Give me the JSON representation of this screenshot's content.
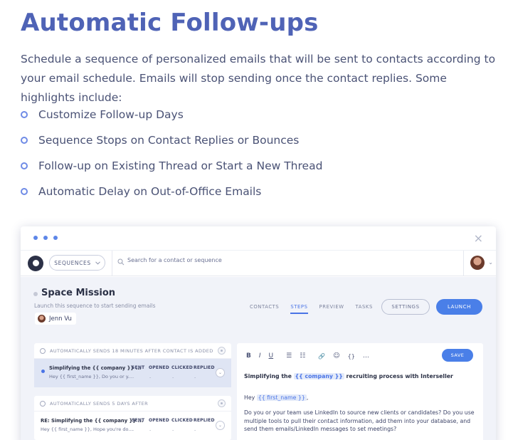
{
  "hero": {
    "title": "Automatic Follow-ups",
    "description": "Schedule a sequence of personalized emails that will be sent to contacts according to your email schedule. Emails will stop sending once the contact replies. Some highlights include:",
    "highlights": [
      "Customize Follow-up Days",
      "Sequence Stops on Contact Replies or Bounces",
      "Follow-up on Existing Thread or Start a New Thread",
      "Automatic Delay on Out-of-Office Emails"
    ]
  },
  "app": {
    "window": {
      "close_icon": "×"
    },
    "nav": {
      "sequences_label": "SEQUENCES",
      "search_placeholder": "Search for a contact or sequence"
    },
    "sequence": {
      "title": "Space Mission",
      "subtitle": "Launch this sequence to start sending emails",
      "owner": "Jenn Vu"
    },
    "tabs": [
      "CONTACTS",
      "STEPS",
      "PREVIEW",
      "TASKS"
    ],
    "active_tab": "STEPS",
    "settings_label": "SETTINGS",
    "launch_label": "LAUNCH",
    "stat_headers": [
      "SENT",
      "OPENED",
      "CLICKED",
      "REPLIED"
    ],
    "steps": [
      {
        "header": "AUTOMATICALLY SENDS 18 MINUTES AFTER CONTACT IS ADDED",
        "subject": "Simplifying the {{ company }} ...",
        "snippet": "Hey {{ first_name }}, Do you or y...",
        "stats": [
          "-",
          "-",
          "-",
          "-"
        ]
      },
      {
        "header": "AUTOMATICALLY SENDS 5 DAYS AFTER",
        "subject": "RE: Simplifying the {{ company }} ...",
        "snippet": "Hey {{ first_name }}, Hope you're do...",
        "stats": [
          "-",
          "-",
          "-",
          "-"
        ]
      }
    ],
    "editor": {
      "toolbar": [
        "B",
        "I",
        "U",
        "☰",
        "☷",
        "🔗",
        "☺",
        "{}",
        "…"
      ],
      "save_label": "SAVE",
      "subject_prefix": "Simplifying the ",
      "subject_var": "{{ company }}",
      "subject_suffix": " recruiting process with Interseller",
      "greeting_prefix": "Hey ",
      "greeting_var": "{{ first_name }}",
      "greeting_suffix": ",",
      "body": "Do you or your team use LinkedIn to source new clients or candidates? Do you use multiple tools to pull their contact information, add them into your database, and send them emails/LinkedIn messages to set meetings?"
    }
  },
  "colors": {
    "title": "#4f63b6",
    "accent": "#4a7fe8",
    "bullet": "#6f8be6",
    "panel_bg": "#f1f3f9"
  }
}
